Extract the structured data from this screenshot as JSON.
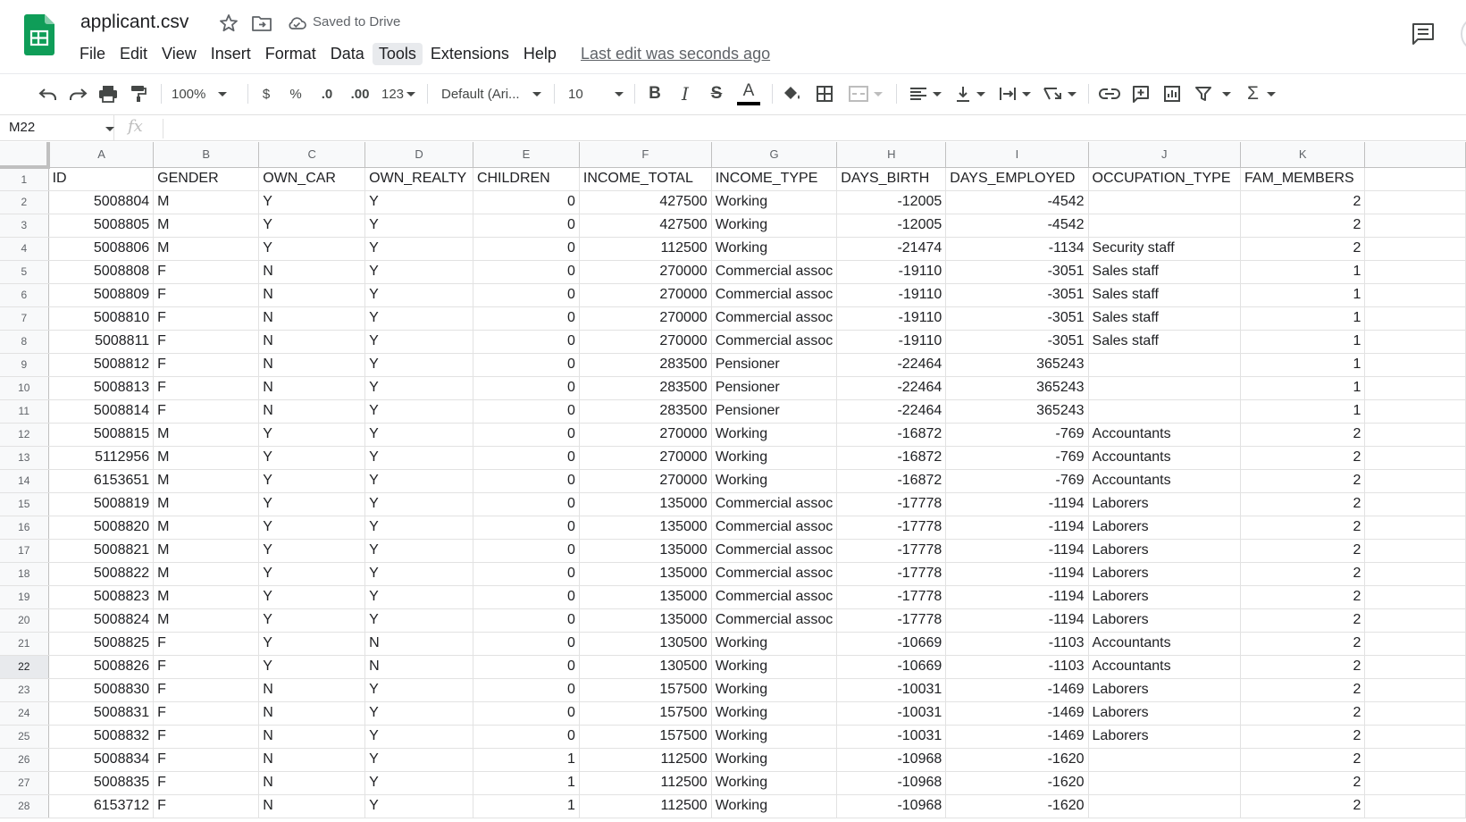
{
  "app": {
    "doc_title": "applicant.csv",
    "saved_status": "Saved to Drive",
    "last_edit": "Last edit was seconds ago",
    "brand_color": "#0f9d58"
  },
  "menu": [
    "File",
    "Edit",
    "View",
    "Insert",
    "Format",
    "Data",
    "Tools",
    "Extensions",
    "Help"
  ],
  "menu_active": "Tools",
  "toolbar": {
    "zoom": "100%",
    "currency": "$",
    "percent": "%",
    "dec_decrease": ".0",
    "dec_increase": ".00",
    "more_formats": "123",
    "font": "Default (Ari...",
    "font_size": "10",
    "bold": "B",
    "italic": "I",
    "strike": "S",
    "text_color": "A",
    "sum_label": "Σ"
  },
  "formula_bar": {
    "name_box": "M22",
    "fx": "fx"
  },
  "grid": {
    "selected_row": "22",
    "columns": [
      "A",
      "B",
      "C",
      "D",
      "E",
      "F",
      "G",
      "H",
      "I",
      "J",
      "K"
    ],
    "header_row": [
      "ID",
      "GENDER",
      "OWN_CAR",
      "OWN_REALTY",
      "CHILDREN",
      "INCOME_TOTAL",
      "INCOME_TYPE",
      "DAYS_BIRTH",
      "DAYS_EMPLOYED",
      "OCCUPATION_TYPE",
      "FAM_MEMBERS"
    ],
    "rows": [
      [
        "5008804",
        "M",
        "Y",
        "Y",
        "0",
        "427500",
        "Working",
        "-12005",
        "-4542",
        "",
        "2"
      ],
      [
        "5008805",
        "M",
        "Y",
        "Y",
        "0",
        "427500",
        "Working",
        "-12005",
        "-4542",
        "",
        "2"
      ],
      [
        "5008806",
        "M",
        "Y",
        "Y",
        "0",
        "112500",
        "Working",
        "-21474",
        "-1134",
        "Security staff",
        "2"
      ],
      [
        "5008808",
        "F",
        "N",
        "Y",
        "0",
        "270000",
        "Commercial assoc",
        "-19110",
        "-3051",
        "Sales staff",
        "1"
      ],
      [
        "5008809",
        "F",
        "N",
        "Y",
        "0",
        "270000",
        "Commercial assoc",
        "-19110",
        "-3051",
        "Sales staff",
        "1"
      ],
      [
        "5008810",
        "F",
        "N",
        "Y",
        "0",
        "270000",
        "Commercial assoc",
        "-19110",
        "-3051",
        "Sales staff",
        "1"
      ],
      [
        "5008811",
        "F",
        "N",
        "Y",
        "0",
        "270000",
        "Commercial assoc",
        "-19110",
        "-3051",
        "Sales staff",
        "1"
      ],
      [
        "5008812",
        "F",
        "N",
        "Y",
        "0",
        "283500",
        "Pensioner",
        "-22464",
        "365243",
        "",
        "1"
      ],
      [
        "5008813",
        "F",
        "N",
        "Y",
        "0",
        "283500",
        "Pensioner",
        "-22464",
        "365243",
        "",
        "1"
      ],
      [
        "5008814",
        "F",
        "N",
        "Y",
        "0",
        "283500",
        "Pensioner",
        "-22464",
        "365243",
        "",
        "1"
      ],
      [
        "5008815",
        "M",
        "Y",
        "Y",
        "0",
        "270000",
        "Working",
        "-16872",
        "-769",
        "Accountants",
        "2"
      ],
      [
        "5112956",
        "M",
        "Y",
        "Y",
        "0",
        "270000",
        "Working",
        "-16872",
        "-769",
        "Accountants",
        "2"
      ],
      [
        "6153651",
        "M",
        "Y",
        "Y",
        "0",
        "270000",
        "Working",
        "-16872",
        "-769",
        "Accountants",
        "2"
      ],
      [
        "5008819",
        "M",
        "Y",
        "Y",
        "0",
        "135000",
        "Commercial assoc",
        "-17778",
        "-1194",
        "Laborers",
        "2"
      ],
      [
        "5008820",
        "M",
        "Y",
        "Y",
        "0",
        "135000",
        "Commercial assoc",
        "-17778",
        "-1194",
        "Laborers",
        "2"
      ],
      [
        "5008821",
        "M",
        "Y",
        "Y",
        "0",
        "135000",
        "Commercial assoc",
        "-17778",
        "-1194",
        "Laborers",
        "2"
      ],
      [
        "5008822",
        "M",
        "Y",
        "Y",
        "0",
        "135000",
        "Commercial assoc",
        "-17778",
        "-1194",
        "Laborers",
        "2"
      ],
      [
        "5008823",
        "M",
        "Y",
        "Y",
        "0",
        "135000",
        "Commercial assoc",
        "-17778",
        "-1194",
        "Laborers",
        "2"
      ],
      [
        "5008824",
        "M",
        "Y",
        "Y",
        "0",
        "135000",
        "Commercial assoc",
        "-17778",
        "-1194",
        "Laborers",
        "2"
      ],
      [
        "5008825",
        "F",
        "Y",
        "N",
        "0",
        "130500",
        "Working",
        "-10669",
        "-1103",
        "Accountants",
        "2"
      ],
      [
        "5008826",
        "F",
        "Y",
        "N",
        "0",
        "130500",
        "Working",
        "-10669",
        "-1103",
        "Accountants",
        "2"
      ],
      [
        "5008830",
        "F",
        "N",
        "Y",
        "0",
        "157500",
        "Working",
        "-10031",
        "-1469",
        "Laborers",
        "2"
      ],
      [
        "5008831",
        "F",
        "N",
        "Y",
        "0",
        "157500",
        "Working",
        "-10031",
        "-1469",
        "Laborers",
        "2"
      ],
      [
        "5008832",
        "F",
        "N",
        "Y",
        "0",
        "157500",
        "Working",
        "-10031",
        "-1469",
        "Laborers",
        "2"
      ],
      [
        "5008834",
        "F",
        "N",
        "Y",
        "1",
        "112500",
        "Working",
        "-10968",
        "-1620",
        "",
        "2"
      ],
      [
        "5008835",
        "F",
        "N",
        "Y",
        "1",
        "112500",
        "Working",
        "-10968",
        "-1620",
        "",
        "2"
      ],
      [
        "6153712",
        "F",
        "N",
        "Y",
        "1",
        "112500",
        "Working",
        "-10968",
        "-1620",
        "",
        "2"
      ]
    ]
  }
}
